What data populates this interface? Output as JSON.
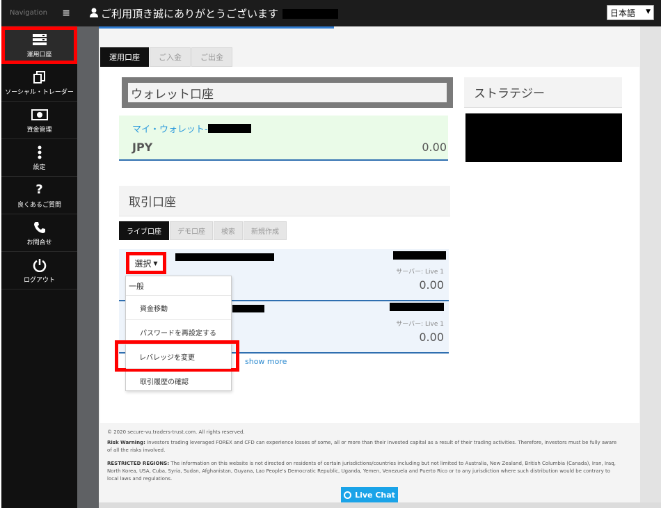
{
  "sidebar": {
    "nav_label": "Navigation",
    "items": [
      {
        "label": "運用口座",
        "icon": "server-stack-icon",
        "active": true
      },
      {
        "label": "ソーシャル・トレーダー",
        "icon": "copy-icon"
      },
      {
        "label": "資金管理",
        "icon": "money-icon"
      },
      {
        "label": "設定",
        "icon": "vertical-dots-icon"
      },
      {
        "label": "良くあるご質問",
        "icon": "question-icon"
      },
      {
        "label": "お問合せ",
        "icon": "phone-icon"
      },
      {
        "label": "ログアウト",
        "icon": "power-icon"
      }
    ]
  },
  "topbar": {
    "greeting": "ご利用頂き誠にありがとうございます",
    "language": "日本語"
  },
  "main_tabs": [
    "運用口座",
    "ご入金",
    "ご出金"
  ],
  "wallet": {
    "title": "ウォレット口座",
    "name": "マイ・ウォレット-",
    "currency": "JPY",
    "balance": "0.00"
  },
  "trading": {
    "title": "取引口座",
    "tabs": [
      "ライブ口座",
      "デモ口座",
      "検索",
      "新規作成"
    ],
    "accounts": [
      {
        "server": "サーバー: Live 1",
        "balance": "0.00"
      },
      {
        "server": "サーバー: Live 1",
        "balance": "0.00"
      }
    ],
    "show_more": "show more"
  },
  "select_menu": {
    "button_label": "選択",
    "group": "一般",
    "items": [
      "資金移動",
      "パスワードを再設定する",
      "レバレッジを変更",
      "取引履歴の確認"
    ],
    "highlighted_index": 2
  },
  "strategy": {
    "title": "ストラテジー"
  },
  "footer": {
    "copyright": "© 2020 secure-vu.traders-trust.com. All rights reserved.",
    "risk_label": "Risk Warning:",
    "risk_text": "Investors trading leveraged FOREX and CFD can experience losses of some, all or more than their invested capital as a result of their trading activities. Therefore, investors must be fully aware of all the risks involved.",
    "restricted_label": "RESTRICTED REGIONS:",
    "restricted_text": "The information on this website is not directed on residents of certain jurisdictions/countries including but not limited to Australia, New Zealand, British Columbia (Canada), Iran, Iraq, North Korea, USA, Cuba, Syria, Sudan, Afghanistan, Guyana, Lao People's Democratic Republic, Uganda, Yemen, Venezuela and Puerto Rico or to any jurisdiction where such distribution would be contrary to local laws and regulations."
  },
  "live_chat": "Live Chat",
  "colors": {
    "accent": "#2f7bd0",
    "highlight": "#ff0000",
    "wallet_bg": "#eafbe8",
    "live_chat": "#1aa3e8"
  }
}
